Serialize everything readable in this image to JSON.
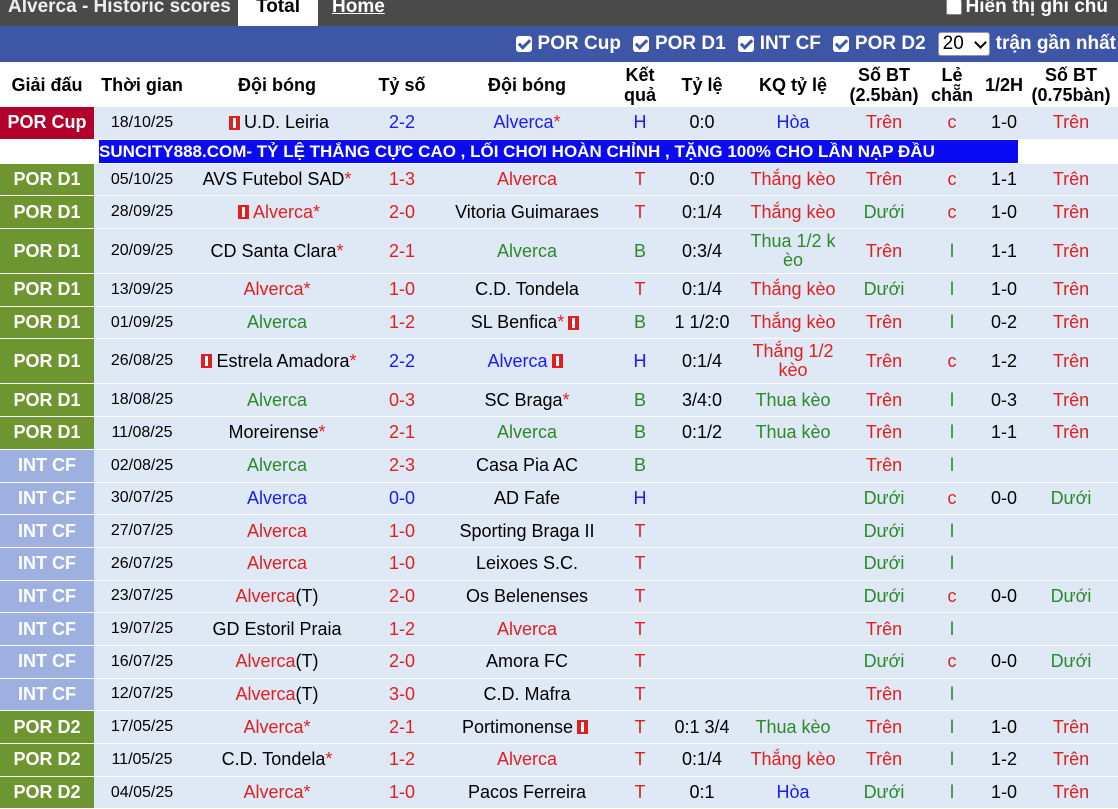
{
  "header": {
    "title": "Alverca - Historic scores",
    "tab_total": "Total",
    "tab_home": "Home",
    "show_full": "Hiển thị ghi chú"
  },
  "filters": {
    "items": [
      "POR Cup",
      "POR D1",
      "INT CF",
      "POR D2"
    ],
    "count_value": "20",
    "count_suffix": "trận gần nhất"
  },
  "columns": {
    "league": "Giải đấu",
    "time": "Thời gian",
    "home": "Đội bóng",
    "score": "Tỷ số",
    "away": "Đội bóng",
    "result": "Kết quả",
    "odds": "Tỷ lệ",
    "odds_result": "KQ tỷ lệ",
    "ou_25": "Số BT (2.5bàn)",
    "oddeven": "Lẻ chẵn",
    "half": "1/2H",
    "ou_075": "Số BT (0.75bàn)"
  },
  "ad_text": "SUNCITY888.COM- TỶ LỆ THẮNG CỰC CAO , LỐI CHƠI HOÀN CHỈNH , TẶNG 100% CHO LẦN NẠP ĐẦU",
  "colors": {
    "league_cup": "#b2002a",
    "league_d1": "#6e9630",
    "league_intcf": "#9db0e0",
    "league_d2": "#6e9630",
    "filter_bar": "#3d56a5",
    "row_bg": "#dfe8f5"
  },
  "rows": [
    {
      "league": "POR Cup",
      "date": "18/10/25",
      "home": "U.D. Leiria",
      "home_color": "black",
      "home_star": false,
      "home_flag": "left",
      "home_suffix": "",
      "score": "2-2",
      "score_color": "blue",
      "away": "Alverca",
      "away_color": "blue",
      "away_star": true,
      "away_flag": "",
      "result": "H",
      "result_color": "blue",
      "odds": "0:0",
      "odds_result": "Hòa",
      "odds_result_color": "blue",
      "ou": "Trên",
      "ou_color": "red",
      "oe": "c",
      "oe_color": "red",
      "half": "1-0",
      "ou2": "Trên",
      "ou2_color": "red"
    },
    {
      "league": "POR D1",
      "date": "05/10/25",
      "home": "AVS Futebol SAD",
      "home_color": "black",
      "home_star": true,
      "home_flag": "",
      "home_suffix": "",
      "score": "1-3",
      "score_color": "red",
      "away": "Alverca",
      "away_color": "red",
      "away_star": false,
      "away_flag": "",
      "result": "T",
      "result_color": "red",
      "odds": "0:0",
      "odds_result": "Thắng kèo",
      "odds_result_color": "red",
      "ou": "Trên",
      "ou_color": "red",
      "oe": "c",
      "oe_color": "red",
      "half": "1-1",
      "ou2": "Trên",
      "ou2_color": "red"
    },
    {
      "league": "POR D1",
      "date": "28/09/25",
      "home": "Alverca",
      "home_color": "red",
      "home_star": true,
      "home_flag": "left",
      "home_suffix": "",
      "score": "2-0",
      "score_color": "red",
      "away": "Vitoria Guimaraes",
      "away_color": "black",
      "away_star": false,
      "away_flag": "",
      "result": "T",
      "result_color": "red",
      "odds": "0:1/4",
      "odds_result": "Thắng kèo",
      "odds_result_color": "red",
      "ou": "Dưới",
      "ou_color": "green",
      "oe": "c",
      "oe_color": "red",
      "half": "1-0",
      "ou2": "Trên",
      "ou2_color": "red"
    },
    {
      "league": "POR D1",
      "date": "20/09/25",
      "home": "CD Santa Clara",
      "home_color": "black",
      "home_star": true,
      "home_flag": "",
      "home_suffix": "",
      "score": "2-1",
      "score_color": "red",
      "away": "Alverca",
      "away_color": "green",
      "away_star": false,
      "away_flag": "",
      "result": "B",
      "result_color": "green",
      "odds": "0:3/4",
      "odds_result": "Thua 1/2 k èo",
      "odds_result_color": "green",
      "tall": true,
      "ou": "Trên",
      "ou_color": "red",
      "oe": "l",
      "oe_color": "green",
      "half": "1-1",
      "ou2": "Trên",
      "ou2_color": "red"
    },
    {
      "league": "POR D1",
      "date": "13/09/25",
      "home": "Alverca",
      "home_color": "red",
      "home_star": true,
      "home_flag": "",
      "home_suffix": "",
      "score": "1-0",
      "score_color": "red",
      "away": "C.D. Tondela",
      "away_color": "black",
      "away_star": false,
      "away_flag": "",
      "result": "T",
      "result_color": "red",
      "odds": "0:1/4",
      "odds_result": "Thắng kèo",
      "odds_result_color": "red",
      "ou": "Dưới",
      "ou_color": "green",
      "oe": "l",
      "oe_color": "green",
      "half": "1-0",
      "ou2": "Trên",
      "ou2_color": "red"
    },
    {
      "league": "POR D1",
      "date": "01/09/25",
      "home": "Alverca",
      "home_color": "green",
      "home_star": false,
      "home_flag": "",
      "home_suffix": "",
      "score": "1-2",
      "score_color": "red",
      "away": "SL Benfica",
      "away_color": "black",
      "away_star": true,
      "away_flag": "right",
      "result": "B",
      "result_color": "green",
      "odds": "1 1/2:0",
      "odds_result": "Thắng kèo",
      "odds_result_color": "red",
      "ou": "Trên",
      "ou_color": "red",
      "oe": "l",
      "oe_color": "green",
      "half": "0-2",
      "ou2": "Trên",
      "ou2_color": "red"
    },
    {
      "league": "POR D1",
      "date": "26/08/25",
      "home": "Estrela Amadora",
      "home_color": "black",
      "home_star": true,
      "home_flag": "left",
      "home_suffix": "",
      "score": "2-2",
      "score_color": "blue",
      "away": "Alverca",
      "away_color": "blue",
      "away_star": false,
      "away_flag": "right",
      "result": "H",
      "result_color": "blue",
      "odds": "0:1/4",
      "odds_result": "Thắng 1/2 kèo",
      "odds_result_color": "red",
      "tall": true,
      "ou": "Trên",
      "ou_color": "red",
      "oe": "c",
      "oe_color": "red",
      "half": "1-2",
      "ou2": "Trên",
      "ou2_color": "red"
    },
    {
      "league": "POR D1",
      "date": "18/08/25",
      "home": "Alverca",
      "home_color": "green",
      "home_star": false,
      "home_flag": "",
      "home_suffix": "",
      "score": "0-3",
      "score_color": "red",
      "away": "SC Braga",
      "away_color": "black",
      "away_star": true,
      "away_flag": "",
      "result": "B",
      "result_color": "green",
      "odds": "3/4:0",
      "odds_result": "Thua kèo",
      "odds_result_color": "green",
      "ou": "Trên",
      "ou_color": "red",
      "oe": "l",
      "oe_color": "green",
      "half": "0-3",
      "ou2": "Trên",
      "ou2_color": "red"
    },
    {
      "league": "POR D1",
      "date": "11/08/25",
      "home": "Moreirense",
      "home_color": "black",
      "home_star": true,
      "home_flag": "",
      "home_suffix": "",
      "score": "2-1",
      "score_color": "red",
      "away": "Alverca",
      "away_color": "green",
      "away_star": false,
      "away_flag": "",
      "result": "B",
      "result_color": "green",
      "odds": "0:1/2",
      "odds_result": "Thua kèo",
      "odds_result_color": "green",
      "ou": "Trên",
      "ou_color": "red",
      "oe": "l",
      "oe_color": "green",
      "half": "1-1",
      "ou2": "Trên",
      "ou2_color": "red"
    },
    {
      "league": "INT CF",
      "date": "02/08/25",
      "home": "Alverca",
      "home_color": "green",
      "home_star": false,
      "home_flag": "",
      "home_suffix": "",
      "score": "2-3",
      "score_color": "red",
      "away": "Casa Pia AC",
      "away_color": "black",
      "away_star": false,
      "away_flag": "",
      "result": "B",
      "result_color": "green",
      "odds": "",
      "odds_result": "",
      "odds_result_color": "black",
      "ou": "Trên",
      "ou_color": "red",
      "oe": "l",
      "oe_color": "green",
      "half": "",
      "ou2": "",
      "ou2_color": "red"
    },
    {
      "league": "INT CF",
      "date": "30/07/25",
      "home": "Alverca",
      "home_color": "blue",
      "home_star": false,
      "home_flag": "",
      "home_suffix": "",
      "score": "0-0",
      "score_color": "blue",
      "away": "AD Fafe",
      "away_color": "black",
      "away_star": false,
      "away_flag": "",
      "result": "H",
      "result_color": "blue",
      "odds": "",
      "odds_result": "",
      "odds_result_color": "black",
      "ou": "Dưới",
      "ou_color": "green",
      "oe": "c",
      "oe_color": "red",
      "half": "0-0",
      "ou2": "Dưới",
      "ou2_color": "green"
    },
    {
      "league": "INT CF",
      "date": "27/07/25",
      "home": "Alverca",
      "home_color": "red",
      "home_star": false,
      "home_flag": "",
      "home_suffix": "",
      "score": "1-0",
      "score_color": "red",
      "away": "Sporting Braga II",
      "away_color": "black",
      "away_star": false,
      "away_flag": "",
      "result": "T",
      "result_color": "red",
      "odds": "",
      "odds_result": "",
      "odds_result_color": "black",
      "ou": "Dưới",
      "ou_color": "green",
      "oe": "l",
      "oe_color": "green",
      "half": "",
      "ou2": "",
      "ou2_color": "red"
    },
    {
      "league": "INT CF",
      "date": "26/07/25",
      "home": "Alverca",
      "home_color": "red",
      "home_star": false,
      "home_flag": "",
      "home_suffix": "",
      "score": "1-0",
      "score_color": "red",
      "away": "Leixoes S.C.",
      "away_color": "black",
      "away_star": false,
      "away_flag": "",
      "result": "T",
      "result_color": "red",
      "odds": "",
      "odds_result": "",
      "odds_result_color": "black",
      "ou": "Dưới",
      "ou_color": "green",
      "oe": "l",
      "oe_color": "green",
      "half": "",
      "ou2": "",
      "ou2_color": "red"
    },
    {
      "league": "INT CF",
      "date": "23/07/25",
      "home": "Alverca",
      "home_color": "red",
      "home_star": false,
      "home_flag": "",
      "home_suffix": "(T)",
      "score": "2-0",
      "score_color": "red",
      "away": "Os Belenenses",
      "away_color": "black",
      "away_star": false,
      "away_flag": "",
      "result": "T",
      "result_color": "red",
      "odds": "",
      "odds_result": "",
      "odds_result_color": "black",
      "ou": "Dưới",
      "ou_color": "green",
      "oe": "c",
      "oe_color": "red",
      "half": "0-0",
      "ou2": "Dưới",
      "ou2_color": "green"
    },
    {
      "league": "INT CF",
      "date": "19/07/25",
      "home": "GD Estoril Praia",
      "home_color": "black",
      "home_star": false,
      "home_flag": "",
      "home_suffix": "",
      "score": "1-2",
      "score_color": "red",
      "away": "Alverca",
      "away_color": "red",
      "away_star": false,
      "away_flag": "",
      "result": "T",
      "result_color": "red",
      "odds": "",
      "odds_result": "",
      "odds_result_color": "black",
      "ou": "Trên",
      "ou_color": "red",
      "oe": "l",
      "oe_color": "green",
      "half": "",
      "ou2": "",
      "ou2_color": "red"
    },
    {
      "league": "INT CF",
      "date": "16/07/25",
      "home": "Alverca",
      "home_color": "red",
      "home_star": false,
      "home_flag": "",
      "home_suffix": "(T)",
      "score": "2-0",
      "score_color": "red",
      "away": "Amora FC",
      "away_color": "black",
      "away_star": false,
      "away_flag": "",
      "result": "T",
      "result_color": "red",
      "odds": "",
      "odds_result": "",
      "odds_result_color": "black",
      "ou": "Dưới",
      "ou_color": "green",
      "oe": "c",
      "oe_color": "red",
      "half": "0-0",
      "ou2": "Dưới",
      "ou2_color": "green"
    },
    {
      "league": "INT CF",
      "date": "12/07/25",
      "home": "Alverca",
      "home_color": "red",
      "home_star": false,
      "home_flag": "",
      "home_suffix": "(T)",
      "score": "3-0",
      "score_color": "red",
      "away": "C.D. Mafra",
      "away_color": "black",
      "away_star": false,
      "away_flag": "",
      "result": "T",
      "result_color": "red",
      "odds": "",
      "odds_result": "",
      "odds_result_color": "black",
      "ou": "Trên",
      "ou_color": "red",
      "oe": "l",
      "oe_color": "green",
      "half": "",
      "ou2": "",
      "ou2_color": "red"
    },
    {
      "league": "POR D2",
      "date": "17/05/25",
      "home": "Alverca",
      "home_color": "red",
      "home_star": true,
      "home_flag": "",
      "home_suffix": "",
      "score": "2-1",
      "score_color": "red",
      "away": "Portimonense",
      "away_color": "black",
      "away_star": false,
      "away_flag": "right",
      "result": "T",
      "result_color": "red",
      "odds": "0:1 3/4",
      "odds_result": "Thua kèo",
      "odds_result_color": "green",
      "ou": "Trên",
      "ou_color": "red",
      "oe": "l",
      "oe_color": "green",
      "half": "1-0",
      "ou2": "Trên",
      "ou2_color": "red"
    },
    {
      "league": "POR D2",
      "date": "11/05/25",
      "home": "C.D. Tondela",
      "home_color": "black",
      "home_star": true,
      "home_flag": "",
      "home_suffix": "",
      "score": "1-2",
      "score_color": "red",
      "away": "Alverca",
      "away_color": "red",
      "away_star": false,
      "away_flag": "",
      "result": "T",
      "result_color": "red",
      "odds": "0:1/4",
      "odds_result": "Thắng kèo",
      "odds_result_color": "red",
      "ou": "Trên",
      "ou_color": "red",
      "oe": "l",
      "oe_color": "green",
      "half": "1-2",
      "ou2": "Trên",
      "ou2_color": "red"
    },
    {
      "league": "POR D2",
      "date": "04/05/25",
      "home": "Alverca",
      "home_color": "red",
      "home_star": true,
      "home_flag": "",
      "home_suffix": "",
      "score": "1-0",
      "score_color": "red",
      "away": "Pacos Ferreira",
      "away_color": "black",
      "away_star": false,
      "away_flag": "",
      "result": "T",
      "result_color": "red",
      "odds": "0:1",
      "odds_result": "Hòa",
      "odds_result_color": "blue",
      "ou": "Dưới",
      "ou_color": "green",
      "oe": "l",
      "oe_color": "green",
      "half": "1-0",
      "ou2": "Trên",
      "ou2_color": "red"
    }
  ]
}
